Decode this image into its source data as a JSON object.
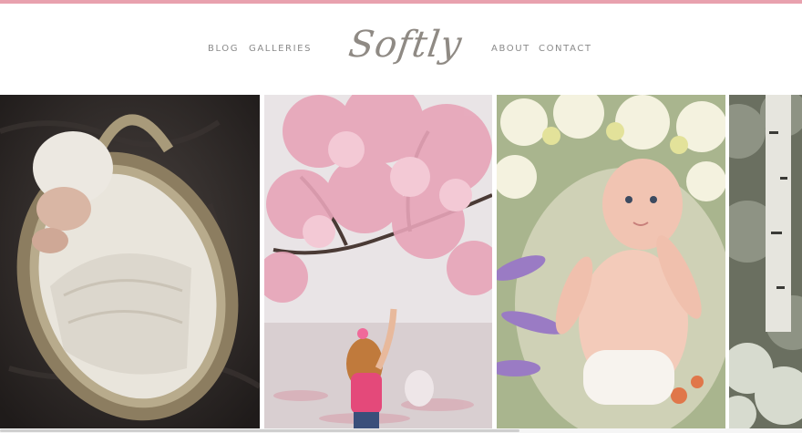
{
  "site": {
    "logo": "Softly"
  },
  "nav": {
    "left": [
      {
        "label": "BLOG"
      },
      {
        "label": "GALLERIES"
      }
    ],
    "right": [
      {
        "label": "ABOUT"
      },
      {
        "label": "CONTACT"
      }
    ]
  },
  "colors": {
    "accent": "#e8a1ae",
    "nav_text": "#8a8a8a",
    "logo_text": "#8f8a84"
  },
  "gallery": {
    "photos": [
      {
        "subject": "newborn-in-wicker-basket-photo"
      },
      {
        "subject": "girl-under-cherry-blossom-photo"
      },
      {
        "subject": "baby-among-lilies-photo"
      },
      {
        "subject": "birch-trees-photo"
      }
    ]
  }
}
